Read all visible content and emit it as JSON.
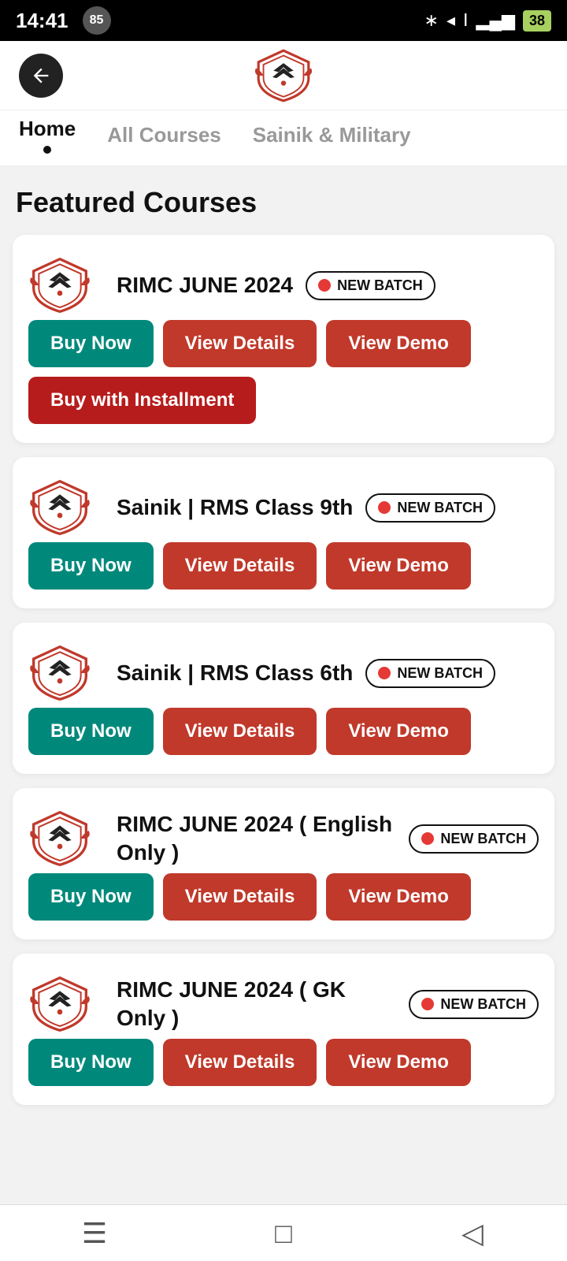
{
  "statusBar": {
    "time": "14:41",
    "badge": "85",
    "battery": "38"
  },
  "header": {
    "backLabel": "back",
    "logoAlt": "Academy Logo"
  },
  "tabs": [
    {
      "id": "home",
      "label": "Home",
      "active": true
    },
    {
      "id": "all-courses",
      "label": "All Courses",
      "active": false
    },
    {
      "id": "sainik-military",
      "label": "Sainik & Military",
      "active": false
    }
  ],
  "sectionTitle": "Featured Courses",
  "courses": [
    {
      "id": "rimc-june-2024",
      "title": "RIMC JUNE 2024",
      "isNewBatch": true,
      "badgeText": "NEW BATCH",
      "buttons": [
        {
          "label": "Buy Now",
          "type": "teal"
        },
        {
          "label": "View Details",
          "type": "red"
        },
        {
          "label": "View Demo",
          "type": "red"
        }
      ],
      "hasInstallment": true,
      "installmentLabel": "Buy with Installment"
    },
    {
      "id": "sainik-rms-9th",
      "title": "Sainik | RMS Class 9th",
      "isNewBatch": true,
      "badgeText": "NEW BATCH",
      "buttons": [
        {
          "label": "Buy Now",
          "type": "teal"
        },
        {
          "label": "View Details",
          "type": "red"
        },
        {
          "label": "View Demo",
          "type": "red"
        }
      ],
      "hasInstallment": false
    },
    {
      "id": "sainik-rms-6th",
      "title": "Sainik | RMS Class 6th",
      "isNewBatch": true,
      "badgeText": "NEW BATCH",
      "buttons": [
        {
          "label": "Buy Now",
          "type": "teal"
        },
        {
          "label": "View Details",
          "type": "red"
        },
        {
          "label": "View Demo",
          "type": "red"
        }
      ],
      "hasInstallment": false
    },
    {
      "id": "rimc-june-2024-english",
      "title": "RIMC JUNE 2024 ( English Only )",
      "isNewBatch": true,
      "badgeText": "NEW BATCH",
      "buttons": [
        {
          "label": "Buy Now",
          "type": "teal"
        },
        {
          "label": "View Details",
          "type": "red"
        },
        {
          "label": "View Demo",
          "type": "red"
        }
      ],
      "hasInstallment": false
    },
    {
      "id": "rimc-june-2024-gk",
      "title": "RIMC JUNE 2024 ( GK Only )",
      "isNewBatch": true,
      "badgeText": "NEW BATCH",
      "buttons": [
        {
          "label": "Buy Now",
          "type": "teal"
        },
        {
          "label": "View Details",
          "type": "red"
        },
        {
          "label": "View Demo",
          "type": "red"
        }
      ],
      "hasInstallment": false
    }
  ],
  "bottomNav": {
    "items": [
      {
        "icon": "menu",
        "label": "Menu"
      },
      {
        "icon": "home",
        "label": "Home"
      },
      {
        "icon": "back",
        "label": "Back"
      }
    ]
  }
}
